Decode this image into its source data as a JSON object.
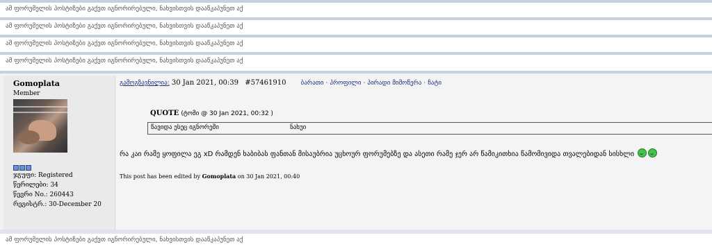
{
  "hidden_notice": "ამ ფორუმელის პოსტიზები გაქვთ იგნორირებული, ნახვისთვის დააწკაპუნეთ აქ",
  "author": {
    "name": "Gomoplata",
    "group": "Member",
    "stats": [
      "ჯგუფი: Registered",
      "წერილები: 34",
      "წევრი No.: 260443",
      "რეგისტრ.: 30-December 20"
    ]
  },
  "post": {
    "poster_label": "გამოგზავნილია:",
    "date": "30 Jan 2021, 00:39",
    "post_id": "#57461910",
    "actions": [
      "ბარათი",
      "პროფილი",
      "პირადი მიმოწერა",
      "ჩატი"
    ],
    "quote": {
      "title": "QUOTE",
      "author_line": "(ტომი @ 30 Jan 2021, 00:32 )",
      "left_text": "წავიდა ესეც იგნორეში",
      "right_text": "ნახუი"
    },
    "text": "რა კაი რამე ყოფილა ეგ xD რამდენ ხაბიბას ფანთან მისაუბრია უცხოურ ფორუმებზე და ასეთი რამე ჯერ არ წამიკითხია წამომივიდა თვალებიდან სისხლი",
    "edited_prefix": "This post has been edited by",
    "edited_by": "Gomoplata",
    "edited_suffix": "on 30 Jan 2021, 00:40"
  }
}
